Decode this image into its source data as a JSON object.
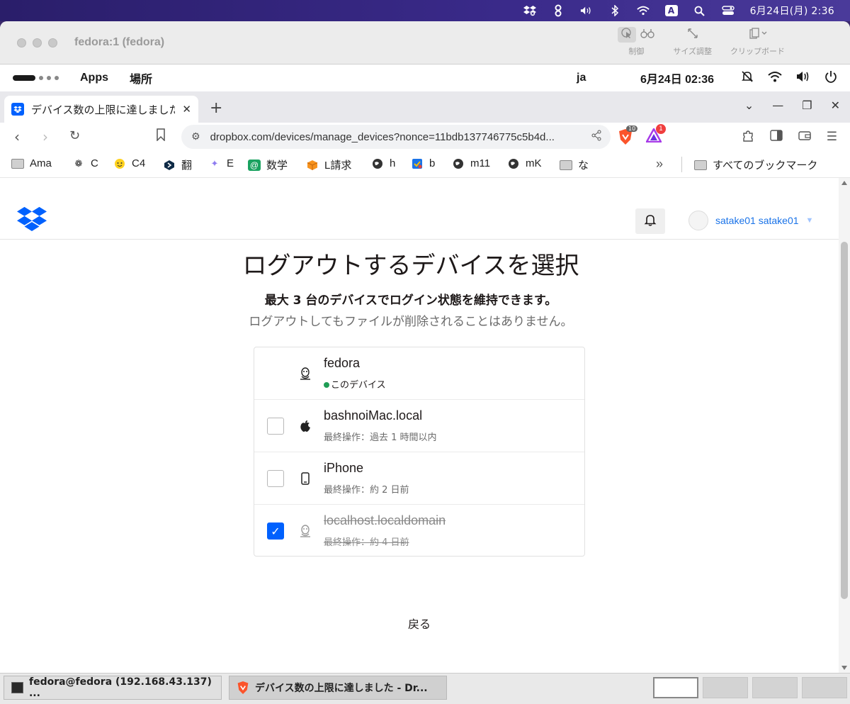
{
  "mac_menubar": {
    "clock": "6月24日(月)  2:36",
    "ime": "A",
    "icons": [
      "dropbox-icon",
      "fingerprint-icon",
      "volume-icon",
      "bluetooth-icon",
      "wifi-icon",
      "input-source-icon",
      "spotlight-icon",
      "control-center-icon"
    ]
  },
  "vnc": {
    "title": "fedora:1 (fedora)",
    "tools": [
      {
        "label": "制御"
      },
      {
        "label": "サイズ調整"
      },
      {
        "label": "クリップボード"
      }
    ]
  },
  "gnome": {
    "apps": "Apps",
    "places": "場所",
    "lang": "ja",
    "date": "6月24日  02:36"
  },
  "browser": {
    "tab_title": "デバイス数の上限に達しました - Dropbox",
    "url": "dropbox.com/devices/manage_devices?nonce=11bdb137746775c5b4d...",
    "shield_count": "10",
    "rewards_count": "1",
    "bookmarks": [
      {
        "label": "Ama",
        "icon": "folder-icon"
      },
      {
        "label": "C",
        "icon": "chatgpt-icon"
      },
      {
        "label": "C4",
        "icon": "huggingface-icon"
      },
      {
        "label": "翻",
        "icon": "deepl-icon"
      },
      {
        "label": "E",
        "icon": "sparkle-icon"
      },
      {
        "label": "数学",
        "icon": "at-icon"
      },
      {
        "label": "L請求",
        "icon": "cube-icon"
      },
      {
        "label": "h",
        "icon": "globe-icon"
      },
      {
        "label": "b",
        "icon": "tasks-icon"
      },
      {
        "label": "m11",
        "icon": "globe-icon"
      },
      {
        "label": "mK",
        "icon": "globe-icon"
      },
      {
        "label": "な",
        "icon": "folder-icon"
      }
    ],
    "all_bookmarks": "すべてのブックマーク"
  },
  "dropbox": {
    "username": "satake01 satake01",
    "title": "ログアウトするデバイスを選択",
    "subtitle": "最大 3 台のデバイスでログイン状態を維持できます。",
    "note": "ログアウトしてもファイルが削除されることはありません。",
    "devices": [
      {
        "name": "fedora",
        "meta": "このデバイス",
        "checked": null,
        "icon": "linux-icon"
      },
      {
        "name": "bashnoiMac.local",
        "meta": "最終操作：過去 1 時間以内",
        "checked": false,
        "icon": "apple-icon"
      },
      {
        "name": "iPhone",
        "meta": "最終操作：約 2 日前",
        "checked": false,
        "icon": "phone-icon"
      },
      {
        "name": "localhost.localdomain",
        "meta": "最終操作：約 4 日前",
        "checked": true,
        "icon": "linux-icon"
      }
    ],
    "back": "戻る"
  },
  "taskbar": {
    "tasks": [
      {
        "label": "fedora@fedora (192.168.43.137) ..."
      },
      {
        "label": "デバイス数の上限に達しました - Dr..."
      }
    ]
  }
}
